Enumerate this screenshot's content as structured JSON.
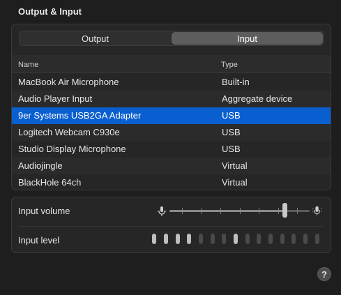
{
  "section": {
    "title": "Output & Input"
  },
  "tabs": [
    {
      "label": "Output",
      "active": false
    },
    {
      "label": "Input",
      "active": true
    }
  ],
  "table": {
    "columns": {
      "name": "Name",
      "type": "Type"
    },
    "rows": [
      {
        "name": "MacBook Air Microphone",
        "type": "Built-in",
        "selected": false
      },
      {
        "name": "Audio Player Input",
        "type": "Aggregate device",
        "selected": false
      },
      {
        "name": "9er Systems USB2GA Adapter",
        "type": "USB",
        "selected": true
      },
      {
        "name": "Logitech Webcam C930e",
        "type": "USB",
        "selected": false
      },
      {
        "name": "Studio Display Microphone",
        "type": "USB",
        "selected": false
      },
      {
        "name": "Audiojingle",
        "type": "Virtual",
        "selected": false
      },
      {
        "name": "BlackHole 64ch",
        "type": "Virtual",
        "selected": false
      }
    ]
  },
  "input": {
    "volume_label": "Input volume",
    "volume_value": 0.82,
    "volume_tick_count": 7,
    "level_label": "Input level",
    "level_segments": 15,
    "level_active": 4,
    "level_peak_index": 7,
    "icons": {
      "volume_low": "microphone-low-icon",
      "volume_high": "microphone-high-icon"
    }
  },
  "help": {
    "label": "?"
  },
  "colors": {
    "selection": "#0a5fd0",
    "background": "#1e1e1e",
    "panel": "#262626"
  }
}
